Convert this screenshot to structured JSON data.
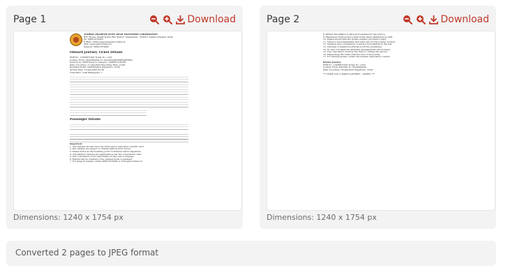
{
  "pages": [
    {
      "label": "Page 1",
      "download_label": "Download",
      "dimensions": "Dimensions: 1240 x 1754 px",
      "doc": {
        "header_lines": [
          "ANDHRA PRADESH STATE ROAD TRANSPORT CORPORATION",
          "RTC House, Pandit Nehru Bus Station, Vijayawada - 520013, Andhra Pradesh, India",
          "Ph: 0866-2570005",
          "E-Mail: online.support@apsrtconline.in",
          "Web: www.apsrtconline.in",
          "Support: 0866-2570005"
        ],
        "title": "Onward Journey Ticket Details",
        "rows": [
          "PNR No: 11938872108   Ticket No: 1231",
          "Journey From: VIJAYAWADA   To: KALYAN(MAHARASHTRA)",
          "Service No: 8558   Service Category: SUPER LUXURY",
          "Date of Journey: 17-Jan-2025   Reporting Time: 14:45",
          "Boarding Point: VIJAYAWADA   Departure: 15:00",
          "Arrival Time: 18-Jan-2025 05:30",
          "Total Fare: 1148   Passengers: 1"
        ],
        "section2": "Passenger Details",
        "section3": "Important :",
        "notes": [
          "1. The traveler should carry the ticket and a valid photo identity card.",
          "2. Bus timings are subject to change without prior notice.",
          "3. Please arrive at the boarding point 15 minutes before departure.",
          "4. Cancellation charges are applicable as per the corporation rules.",
          "5. The corporation is not responsible for any loss of luggage.",
          "6. Refund will be credited to the original mode of payment.",
          "7. For Support details contact 0866-2570005 or visit apsrtconline.in"
        ]
      }
    },
    {
      "label": "Page 2",
      "download_label": "Download",
      "dimensions": "Dimensions: 1240 x 1754 px",
      "doc": {
        "lines": [
          "8. Partial cancellation is allowed if enabled for the service.",
          "9. Passengers must produce their ticket when demanded by staff.",
          "10. Please ensure that the mobile number provided is valid.",
          "11. Ticket is non-transferable and valid only for the journey booked.",
          "12. Smoking and consumption of alcohol is prohibited in the bus.",
          "13. Carrying of hazardous articles is strictly prohibited.",
          "14. In case of breakdown alternate arrangements will be made.",
          "15. The corporation reserves the right to change the service.",
          "16. Please keep the ticket until the end of the journey.",
          "17. For refunds please contact the nearest reservation counter."
        ],
        "return_title": "Return Journey",
        "return_rows": [
          "PNR No: 11938872109   Ticket No: 1232",
          "Journey From: KALYAN   To: VIJAYAWADA",
          "Date of Journey: 25-Jan-2025   Departure: 16:00"
        ],
        "footer": "*** WISH YOU A HAPPY JOURNEY - APSRTC ***"
      }
    }
  ],
  "status_text": "Converted 2 pages to JPEG format",
  "colors": {
    "accent": "#c0392b",
    "card_bg": "#f3f3f3"
  }
}
